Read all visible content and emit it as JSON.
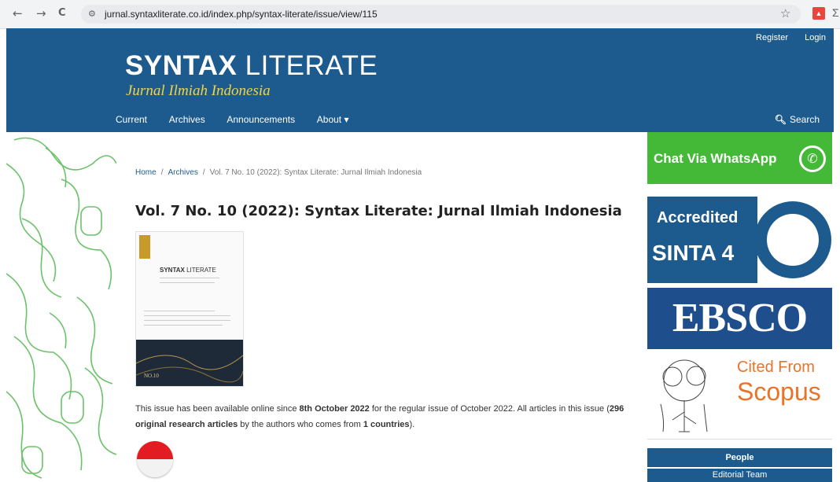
{
  "browser": {
    "back_icon": "←",
    "forward_icon": "→",
    "reload_icon": "C",
    "url": "jurnal.syntaxliterate.co.id/index.php/syntax-literate/issue/view/115",
    "star_icon": "☆"
  },
  "header": {
    "register": "Register",
    "login": "Login",
    "logo_bold": "SYNTAX",
    "logo_light": "LITERATE",
    "logo_sub": "Jurnal Ilmiah Indonesia",
    "nav": [
      "Current",
      "Archives",
      "Announcements",
      "About ▾"
    ],
    "search": "Search",
    "bg_color": "#1d5b8f"
  },
  "breadcrumb": {
    "home": "Home",
    "archives": "Archives",
    "current": "Vol. 7 No. 10 (2022): Syntax Literate: Jurnal Ilmiah Indonesia"
  },
  "issue": {
    "title": "Vol. 7 No. 10 (2022): Syntax Literate: Jurnal Ilmiah Indonesia",
    "cover_title_bold": "SYNTAX",
    "cover_title_light": "LITERATE",
    "cover_number": "NO.10",
    "desc_1": "This issue has been available online since ",
    "desc_date": "8th October 2022",
    "desc_2": " for the regular issue of October 2022. All articles in this issue (",
    "desc_count": "296 original research articles",
    "desc_3": " by the authors who comes from ",
    "desc_countries": "1 countries",
    "desc_4": ")."
  },
  "sidebar": {
    "whatsapp": "Chat Via WhatsApp",
    "accredited": "Accredited",
    "sinta": "SINTA 4",
    "ebsco": "EBSCO",
    "cited_from": "Cited From",
    "scopus": "Scopus",
    "people": "People",
    "editorial_team": "Editorial Team"
  }
}
